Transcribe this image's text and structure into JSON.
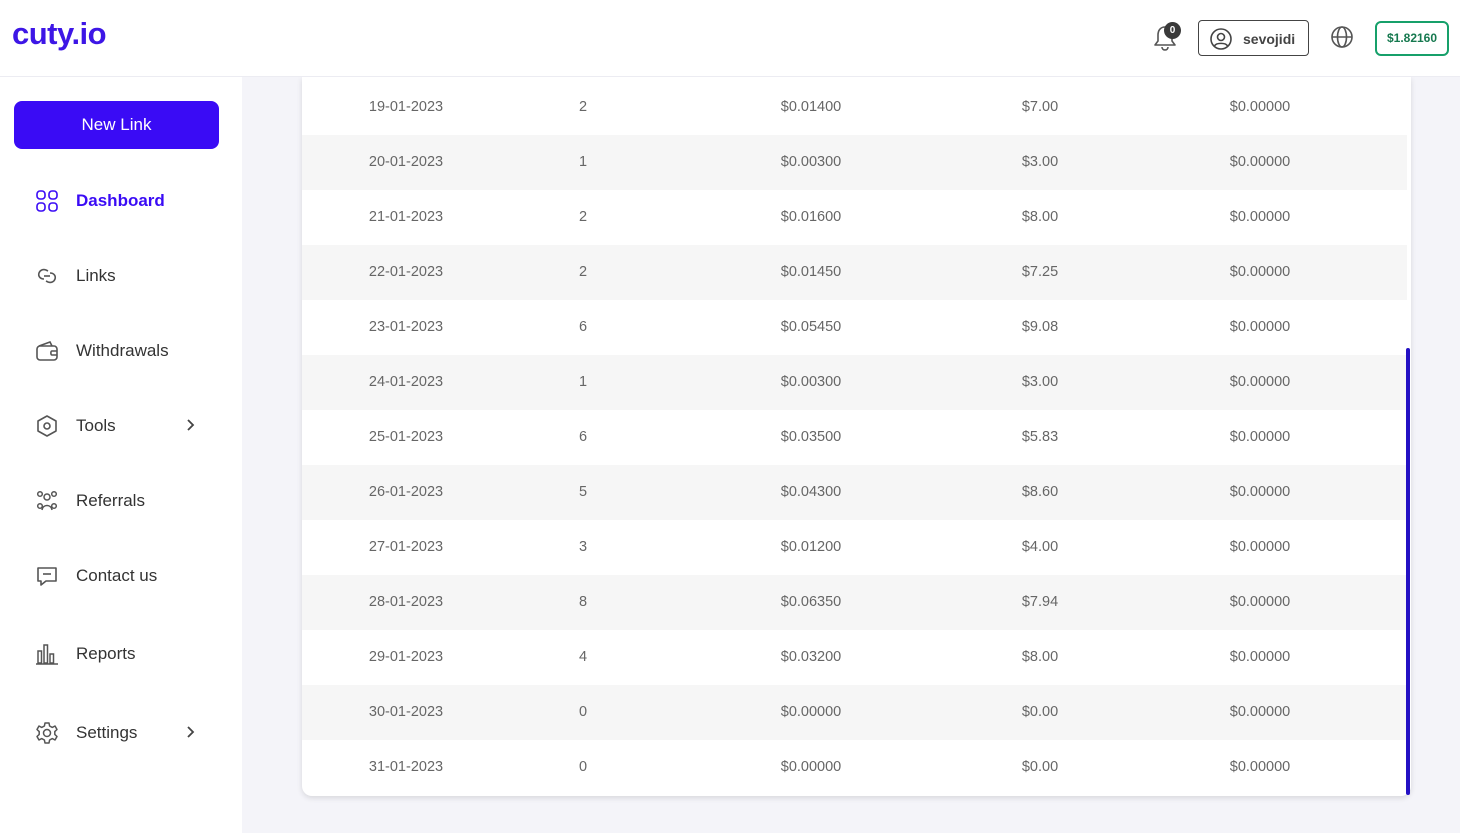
{
  "header": {
    "logo": "cuty.io",
    "notification_count": "0",
    "username": "sevojidi",
    "balance": "$1.82160"
  },
  "sidebar": {
    "new_link_label": "New Link",
    "items": [
      {
        "label": "Dashboard",
        "icon": "grid-icon",
        "active": true
      },
      {
        "label": "Links",
        "icon": "link-icon"
      },
      {
        "label": "Withdrawals",
        "icon": "wallet-icon"
      },
      {
        "label": "Tools",
        "icon": "hexagon-icon",
        "has_submenu": true
      },
      {
        "label": "Referrals",
        "icon": "users-icon"
      },
      {
        "label": "Contact us",
        "icon": "message-icon"
      },
      {
        "label": "Reports",
        "icon": "bar-chart-icon"
      },
      {
        "label": "Settings",
        "icon": "gear-icon",
        "has_submenu": true
      }
    ]
  },
  "table": {
    "rows": [
      {
        "date": "19-01-2023",
        "views": "2",
        "earnings": "$0.01400",
        "cpm": "$7.00",
        "referral": "$0.00000"
      },
      {
        "date": "20-01-2023",
        "views": "1",
        "earnings": "$0.00300",
        "cpm": "$3.00",
        "referral": "$0.00000"
      },
      {
        "date": "21-01-2023",
        "views": "2",
        "earnings": "$0.01600",
        "cpm": "$8.00",
        "referral": "$0.00000"
      },
      {
        "date": "22-01-2023",
        "views": "2",
        "earnings": "$0.01450",
        "cpm": "$7.25",
        "referral": "$0.00000"
      },
      {
        "date": "23-01-2023",
        "views": "6",
        "earnings": "$0.05450",
        "cpm": "$9.08",
        "referral": "$0.00000"
      },
      {
        "date": "24-01-2023",
        "views": "1",
        "earnings": "$0.00300",
        "cpm": "$3.00",
        "referral": "$0.00000"
      },
      {
        "date": "25-01-2023",
        "views": "6",
        "earnings": "$0.03500",
        "cpm": "$5.83",
        "referral": "$0.00000"
      },
      {
        "date": "26-01-2023",
        "views": "5",
        "earnings": "$0.04300",
        "cpm": "$8.60",
        "referral": "$0.00000"
      },
      {
        "date": "27-01-2023",
        "views": "3",
        "earnings": "$0.01200",
        "cpm": "$4.00",
        "referral": "$0.00000"
      },
      {
        "date": "28-01-2023",
        "views": "8",
        "earnings": "$0.06350",
        "cpm": "$7.94",
        "referral": "$0.00000"
      },
      {
        "date": "29-01-2023",
        "views": "4",
        "earnings": "$0.03200",
        "cpm": "$8.00",
        "referral": "$0.00000"
      },
      {
        "date": "30-01-2023",
        "views": "0",
        "earnings": "$0.00000",
        "cpm": "$0.00",
        "referral": "$0.00000"
      },
      {
        "date": "31-01-2023",
        "views": "0",
        "earnings": "$0.00000",
        "cpm": "$0.00",
        "referral": "$0.00000"
      }
    ]
  },
  "colors": {
    "brand": "#3a0bf5",
    "balance_border": "#16a06a",
    "scrollbar": "#2411c4"
  }
}
